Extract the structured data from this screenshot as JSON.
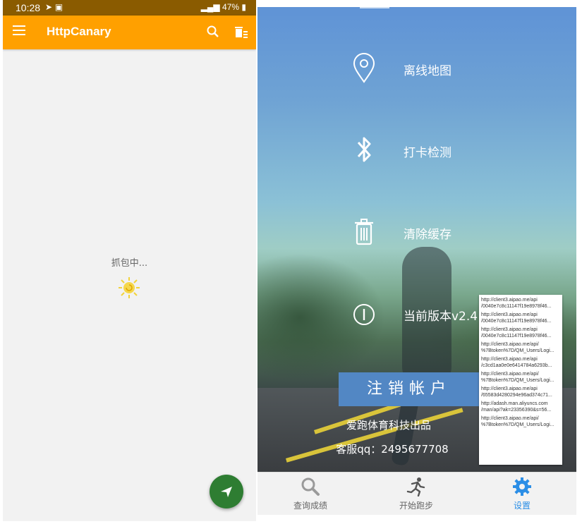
{
  "left_app": {
    "status_bar": {
      "time": "10:28",
      "battery": "47%"
    },
    "toolbar": {
      "title": "HttpCanary"
    },
    "capture_status": "抓包中..."
  },
  "right_app": {
    "menu": [
      {
        "label": "离线地图",
        "icon": "location-pin-icon"
      },
      {
        "label": "打卡检测",
        "icon": "bluetooth-icon"
      },
      {
        "label": "清除缓存",
        "icon": "trash-icon"
      },
      {
        "label": "当前版本v2.4",
        "icon": "info-icon"
      }
    ],
    "logout_label": "注销帐户",
    "company": "爱跑体育科技出品",
    "customer_service": "客服qq：2495677708",
    "url_popup": [
      "http://client3.aipao.me/api",
      "/0040e7c8c11147f19e8978f46...",
      "http://client3.aipao.me/api",
      "/0040e7c8c11147f19e8978f46...",
      "http://client3.aipao.me/api",
      "/0040e7c8c11147f19e8978f46...",
      "http://client3.aipao.me/api/",
      "%7Btoken%7D/QM_Users/Logi...",
      "http://client3.aipao.me/api",
      "/c3cd1aa0e0e6414784a6293b...",
      "http://client3.aipao.me/api/",
      "%7Btoken%7D/QM_Users/Logi...",
      "http://client3.aipao.me/api",
      "/65583d4280294e96ad374c71...",
      "http://adash.man.aliyuncs.com",
      "/man/api?ak=23356390&s=56...",
      "http://client3.aipao.me/api/",
      "%7Btoken%7D/QM_Users/Logi..."
    ],
    "tabs": [
      {
        "label": "查询成绩",
        "icon": "magnifier-icon",
        "active": false
      },
      {
        "label": "开始跑步",
        "icon": "runner-icon",
        "active": false
      },
      {
        "label": "设置",
        "icon": "gear-icon",
        "active": true
      }
    ],
    "colors": {
      "tab_active": "#2b8ee6",
      "logout_bg": "#5287c4"
    }
  }
}
